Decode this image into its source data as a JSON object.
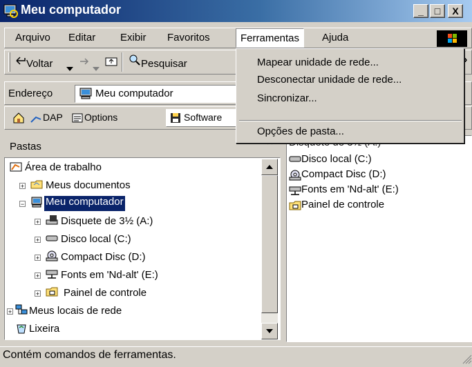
{
  "window": {
    "title": "Meu computador"
  },
  "caption_buttons": {
    "minimize": "_",
    "maximize": "□",
    "close": "X"
  },
  "menubar": {
    "items": [
      "Arquivo",
      "Editar",
      "Exibir",
      "Favoritos",
      "Ferramentas",
      "Ajuda"
    ],
    "active": "Ferramentas"
  },
  "toolbar": {
    "back": "Voltar",
    "search": "Pesquisar",
    "overflow": "»"
  },
  "addressbar": {
    "label": "Endereço",
    "value": "Meu computador"
  },
  "linksbar": {
    "items": [
      "DAP",
      "Options",
      "Software"
    ]
  },
  "tools_menu": {
    "items": [
      "Mapear unidade de rede...",
      "Desconectar unidade de rede...",
      "Sincronizar...",
      "Opções de pasta..."
    ]
  },
  "folders": {
    "header": "Pastas",
    "close": "×",
    "tree": [
      {
        "label": "Área de trabalho",
        "icon": "desktop-icon"
      },
      {
        "label": "Meus documentos",
        "icon": "documents-folder-icon"
      },
      {
        "label": "Meu computador",
        "icon": "computer-icon"
      },
      {
        "label": "Disquete de 3½ (A:)",
        "icon": "floppy-drive-icon"
      },
      {
        "label": "Disco local (C:)",
        "icon": "hard-drive-icon"
      },
      {
        "label": "Compact Disc (D:)",
        "icon": "cd-drive-icon"
      },
      {
        "label": "Fonts em 'Nd-alt' (E:)",
        "icon": "network-drive-icon"
      },
      {
        "label": "Painel de controle",
        "icon": "control-panel-icon"
      },
      {
        "label": "Meus locais de rede",
        "icon": "network-places-icon"
      },
      {
        "label": "Lixeira",
        "icon": "recycle-bin-icon"
      }
    ],
    "selected": "Meu computador"
  },
  "contents": {
    "items": [
      "Disquete de 3½ (A:)",
      "Disco local (C:)",
      "Compact Disc (D:)",
      "Fonts em 'Nd-alt' (E:)",
      "Painel de controle"
    ]
  },
  "statusbar": {
    "text": "Contém comandos de ferramentas."
  },
  "colors": {
    "titlebar": "#0a246a",
    "selection": "#0a246a",
    "face": "#d4d0c8"
  }
}
